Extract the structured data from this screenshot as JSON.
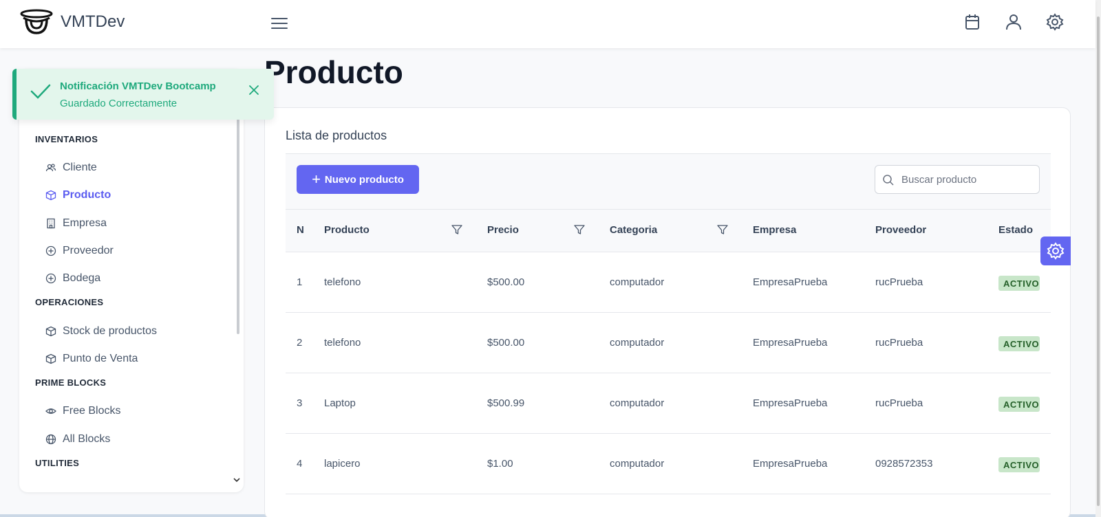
{
  "topbar": {
    "brand_name": "VMTDev",
    "icons": [
      "menu-icon",
      "calendar-icon",
      "user-icon",
      "gear-icon"
    ]
  },
  "toast": {
    "title": "Notificación VMTDev Bootcamp",
    "message": "Guardado Correctamente",
    "color": "#1ea97c"
  },
  "sidebar": {
    "sections": [
      {
        "title": "INVENTARIOS",
        "items": [
          {
            "label": "Cliente",
            "icon": "users-icon"
          },
          {
            "label": "Producto",
            "icon": "box-icon",
            "active": true
          },
          {
            "label": "Empresa",
            "icon": "building-icon"
          },
          {
            "label": "Proveedor",
            "icon": "plus-circle-icon"
          },
          {
            "label": "Bodega",
            "icon": "plus-circle-icon"
          }
        ]
      },
      {
        "title": "OPERACIONES",
        "items": [
          {
            "label": "Stock de productos",
            "icon": "box-icon"
          },
          {
            "label": "Punto de Venta",
            "icon": "box-icon"
          }
        ]
      },
      {
        "title": "PRIME BLOCKS",
        "items": [
          {
            "label": "Free Blocks",
            "icon": "eye-icon"
          },
          {
            "label": "All Blocks",
            "icon": "globe-icon"
          }
        ]
      },
      {
        "title": "UTILITIES",
        "items": []
      }
    ]
  },
  "main": {
    "page_title": "Producto",
    "card_title": "Lista de productos",
    "new_button_label": "Nuevo producto",
    "search_placeholder": "Buscar producto",
    "search_value": "",
    "columns": [
      "N",
      "Producto",
      "Precio",
      "Categoria",
      "Empresa",
      "Proveedor",
      "Estado"
    ],
    "rows": [
      {
        "n": "1",
        "producto": "telefono",
        "precio": "$500.00",
        "categoria": "computador",
        "empresa": "EmpresaPrueba",
        "proveedor": "rucPrueba",
        "estado": "ACTIVO"
      },
      {
        "n": "2",
        "producto": "telefono",
        "precio": "$500.00",
        "categoria": "computador",
        "empresa": "EmpresaPrueba",
        "proveedor": "rucPrueba",
        "estado": "ACTIVO"
      },
      {
        "n": "3",
        "producto": "Laptop",
        "precio": "$500.99",
        "categoria": "computador",
        "empresa": "EmpresaPrueba",
        "proveedor": "rucPrueba",
        "estado": "ACTIVO"
      },
      {
        "n": "4",
        "producto": "lapicero",
        "precio": "$1.00",
        "categoria": "computador",
        "empresa": "EmpresaPrueba",
        "proveedor": "0928572353",
        "estado": "ACTIVO"
      }
    ]
  },
  "colors": {
    "accent": "#6366f1",
    "success": "#1ea97c",
    "badge_bg": "#c8e6c9",
    "badge_text": "#256029"
  }
}
